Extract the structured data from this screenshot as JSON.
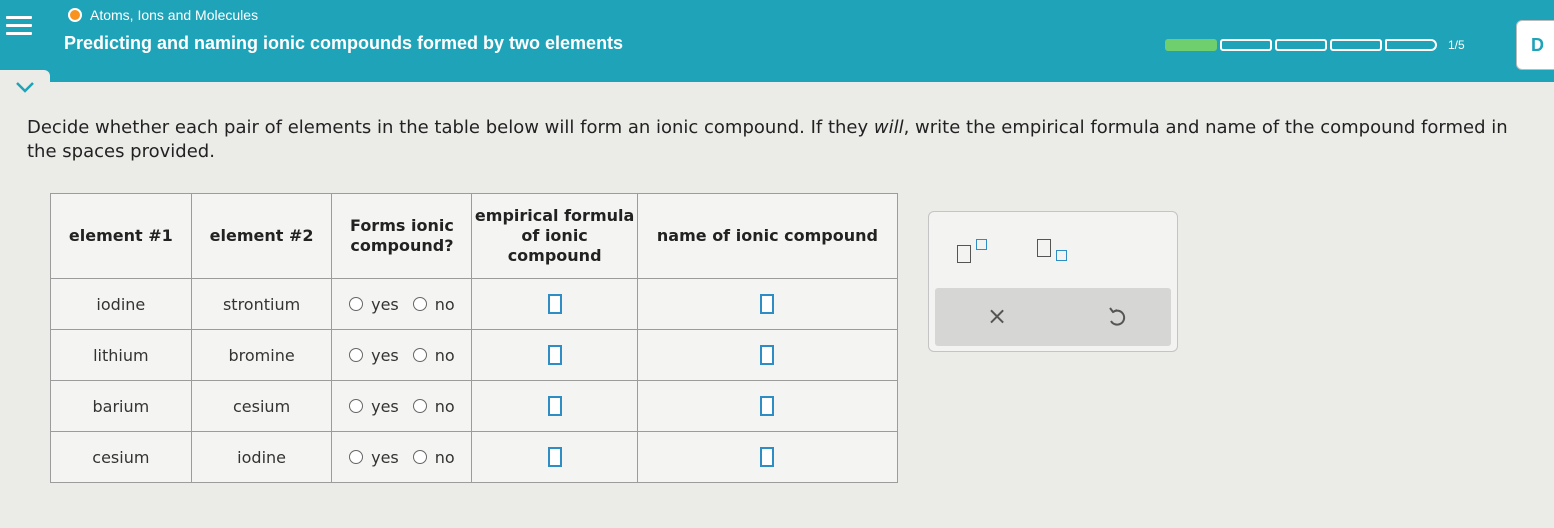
{
  "header": {
    "topic": "Atoms, Ions and Molecules",
    "title": "Predicting and naming ionic compounds formed by two elements",
    "progress": {
      "filled": 1,
      "total": 5,
      "label": "1/5"
    },
    "corner_letter": "D",
    "accent_color": "#1fa3b8"
  },
  "instructions": {
    "part1": "Decide whether each pair of elements in the table below will form an ionic compound. If they ",
    "emphasis": "will",
    "part2": ", write the empirical formula and name of the compound formed in the spaces provided."
  },
  "table": {
    "headers": {
      "element1": "element #1",
      "element2": "element #2",
      "forms": "Forms ionic compound?",
      "formula": "empirical formula of ionic compound",
      "name": "name of ionic compound"
    },
    "option_yes": "yes",
    "option_no": "no",
    "rows": [
      {
        "element1": "iodine",
        "element2": "strontium"
      },
      {
        "element1": "lithium",
        "element2": "bromine"
      },
      {
        "element1": "barium",
        "element2": "cesium"
      },
      {
        "element1": "cesium",
        "element2": "iodine"
      }
    ]
  },
  "toolbar": {
    "clear_symbol": "×",
    "icons": [
      "superscript-icon",
      "subscript-icon",
      "clear-icon",
      "undo-icon"
    ]
  }
}
